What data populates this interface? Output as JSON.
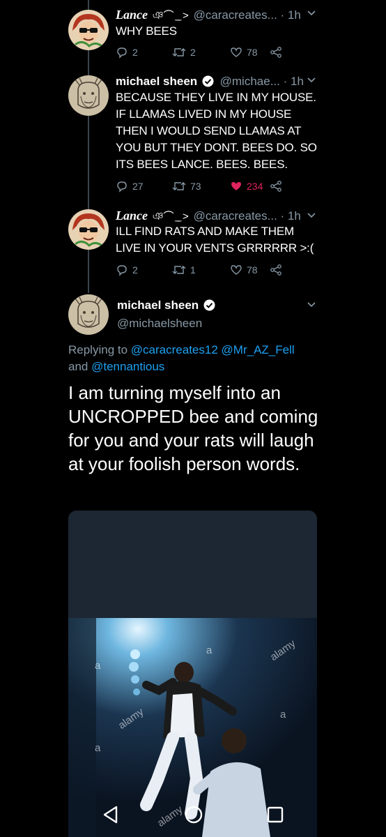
{
  "tweets": [
    {
      "name": "Lance",
      "name_deco": "ঞ⌒ ̫ ̫ >",
      "handle": "@caracreates...",
      "time": "· 1h",
      "text": "WHY BEES",
      "replies": "2",
      "retweets": "2",
      "likes": "78"
    },
    {
      "name": "michael sheen",
      "handle": "@michae...",
      "time": "· 1h",
      "text": "BECAUSE THEY LIVE IN MY HOUSE.\nIF LLAMAS LIVED IN MY HOUSE\nTHEN I WOULD SEND LLAMAS AT\nYOU BUT THEY DONT. BEES DO. SO\nITS BEES LANCE. BEES. BEES.",
      "replies": "27",
      "retweets": "73",
      "likes": "234"
    },
    {
      "name": "Lance",
      "name_deco": "ঞ⌒ ̫ ̫ >",
      "handle": "@caracreates...",
      "time": "· 1h",
      "text": "ILL FIND RATS AND MAKE THEM\nLIVE IN YOUR VENTS GRRRRRR >:(",
      "replies": "2",
      "retweets": "1",
      "likes": "78"
    }
  ],
  "main_tweet": {
    "name": "michael sheen",
    "handle": "@michaelsheen",
    "replying_prefix": "Replying to",
    "reply_to_1": "@caracreates12",
    "reply_to_2": "@Mr_AZ_Fell",
    "reply_and": "and",
    "reply_to_3": "@tennantious",
    "text": "I am turning myself into an UNCROPPED bee and coming for you and your rats will laugh at your foolish person words.",
    "watermarks": [
      "alamy",
      "alamy",
      "alamy",
      "a",
      "a",
      "a",
      "a"
    ]
  },
  "colors": {
    "background": "#000000",
    "secondary_text": "#8899a6",
    "link": "#1da1f2",
    "like": "#e0245e",
    "thread_line": "#38444d"
  },
  "icons": [
    "reply-icon",
    "retweet-icon",
    "heart-icon",
    "share-icon",
    "verified-icon",
    "chevron-down-icon",
    "back-icon",
    "home-icon",
    "recents-icon"
  ]
}
